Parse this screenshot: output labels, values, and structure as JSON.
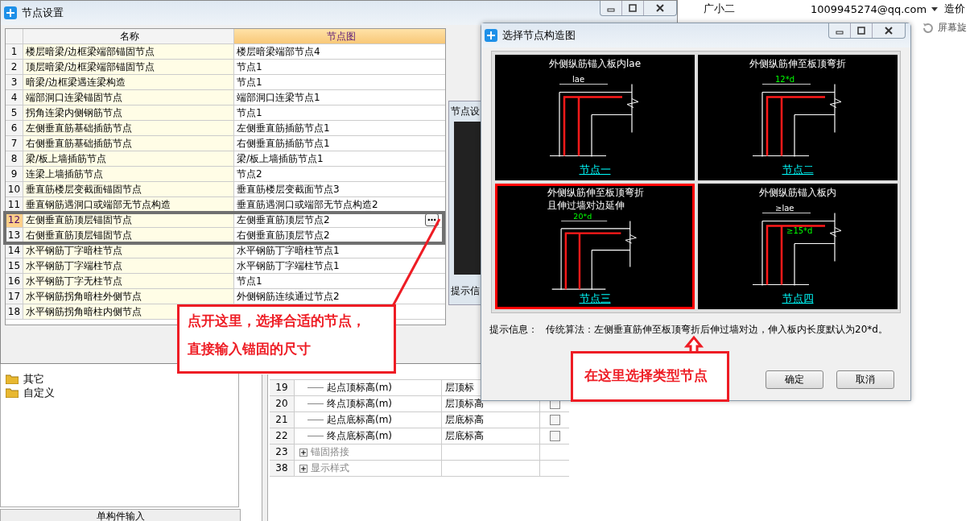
{
  "app": {
    "user": "广小二",
    "account": "1009945274@qq.com",
    "menu_cut": "造价",
    "toolbar_cut": "屏幕旋"
  },
  "tree": [
    {
      "label": "其它"
    },
    {
      "label": "自定义"
    }
  ],
  "bottom_tab": "单构件输入",
  "properties": [
    {
      "num": "19",
      "name": "起点顶标高(m)",
      "value": "层顶标",
      "kind": "leaf"
    },
    {
      "num": "20",
      "name": "终点顶标高(m)",
      "value": "层顶标高",
      "kind": "leaf",
      "checked": false
    },
    {
      "num": "21",
      "name": "起点底标高(m)",
      "value": "层底标高",
      "kind": "leaf",
      "checked": false
    },
    {
      "num": "22",
      "name": "终点底标高(m)",
      "value": "层底标高",
      "kind": "leaf",
      "checked": false
    },
    {
      "num": "23",
      "name": "锚固搭接",
      "kind": "group",
      "expanded": false
    },
    {
      "num": "38",
      "name": "显示样式",
      "kind": "group",
      "expanded": false
    }
  ],
  "back_dialog": {
    "title": "节点设",
    "hint": "提示信"
  },
  "node_settings": {
    "title": "节点设置",
    "columns": [
      "名称",
      "节点图"
    ],
    "rows": [
      {
        "num": "1",
        "name": "楼层暗梁/边框梁端部锚固节点",
        "value": "楼层暗梁端部节点4",
        "selected": false
      },
      {
        "num": "2",
        "name": "顶层暗梁/边框梁端部锚固节点",
        "value": "节点1",
        "selected": false
      },
      {
        "num": "3",
        "name": "暗梁/边框梁遇连梁构造",
        "value": "节点1",
        "selected": false
      },
      {
        "num": "4",
        "name": "端部洞口连梁锚固节点",
        "value": "端部洞口连梁节点1",
        "selected": false
      },
      {
        "num": "5",
        "name": "拐角连梁内侧钢筋节点",
        "value": "节点1",
        "selected": false
      },
      {
        "num": "6",
        "name": "左侧垂直筋基础插筋节点",
        "value": "左侧垂直筋插筋节点1",
        "selected": false
      },
      {
        "num": "7",
        "name": "右侧垂直筋基础插筋节点",
        "value": "右侧垂直筋插筋节点1",
        "selected": false
      },
      {
        "num": "8",
        "name": "梁/板上墙插筋节点",
        "value": "梁/板上墙插筋节点1",
        "selected": false
      },
      {
        "num": "9",
        "name": "连梁上墙插筋节点",
        "value": "节点2",
        "selected": false
      },
      {
        "num": "10",
        "name": "垂直筋楼层变截面锚固节点",
        "value": "垂直筋楼层变截面节点3",
        "selected": false
      },
      {
        "num": "11",
        "name": "垂直钢筋遇洞口或端部无节点构造",
        "value": "垂直筋遇洞口或端部无节点构造2",
        "selected": false
      },
      {
        "num": "12",
        "name": "左侧垂直筋顶层锚固节点",
        "value": "左侧垂直筋顶层节点2",
        "selected": true
      },
      {
        "num": "13",
        "name": "右侧垂直筋顶层锚固节点",
        "value": "右侧垂直筋顶层节点2",
        "selected": false
      },
      {
        "num": "14",
        "name": "水平钢筋丁字暗柱节点",
        "value": "水平钢筋丁字暗柱节点1",
        "selected": false
      },
      {
        "num": "15",
        "name": "水平钢筋丁字端柱节点",
        "value": "水平钢筋丁字端柱节点1",
        "selected": false
      },
      {
        "num": "16",
        "name": "水平钢筋丁字无柱节点",
        "value": "节点1",
        "selected": false
      },
      {
        "num": "17",
        "name": "水平钢筋拐角暗柱外侧节点",
        "value": "外侧钢筋连续通过节点2",
        "selected": false
      },
      {
        "num": "18",
        "name": "水平钢筋拐角暗柱内侧节点",
        "selected": false
      }
    ]
  },
  "picker": {
    "title": "选择节点构造图",
    "options": [
      {
        "title": [
          "外侧纵筋锚入板内lae"
        ],
        "label": "节点一",
        "selected": false,
        "dims": [
          {
            "text": "lae",
            "kind": "length"
          }
        ]
      },
      {
        "title": [
          "外侧纵筋伸至板顶弯折"
        ],
        "label": "节点二",
        "selected": false,
        "dims": [
          {
            "text": "12*d",
            "kind": "bend"
          }
        ]
      },
      {
        "title": [
          "外侧纵筋伸至板顶弯折",
          "且伸过墙对边延伸"
        ],
        "label": "节点三",
        "selected": true,
        "dims": [
          {
            "text": "20*d",
            "kind": "bend"
          }
        ]
      },
      {
        "title": [
          "外侧纵筋锚入板内"
        ],
        "label": "节点四",
        "selected": false,
        "dims": [
          {
            "text": "≥lae",
            "kind": "length"
          },
          {
            "text": "≥15*d",
            "kind": "bend"
          }
        ]
      }
    ],
    "hint_label": "提示信息：",
    "hint": "传统算法：左侧垂直筋伸至板顶弯折后伸过墙对边，伸入板内长度默认为20*d。",
    "buttons": [
      "确定",
      "取消"
    ]
  },
  "annotations": [
    {
      "lines": [
        "点开这里，选择合适的节点，",
        "直接输入锚固的尺寸"
      ]
    },
    {
      "lines": [
        "在这里选择类型节点"
      ]
    }
  ]
}
